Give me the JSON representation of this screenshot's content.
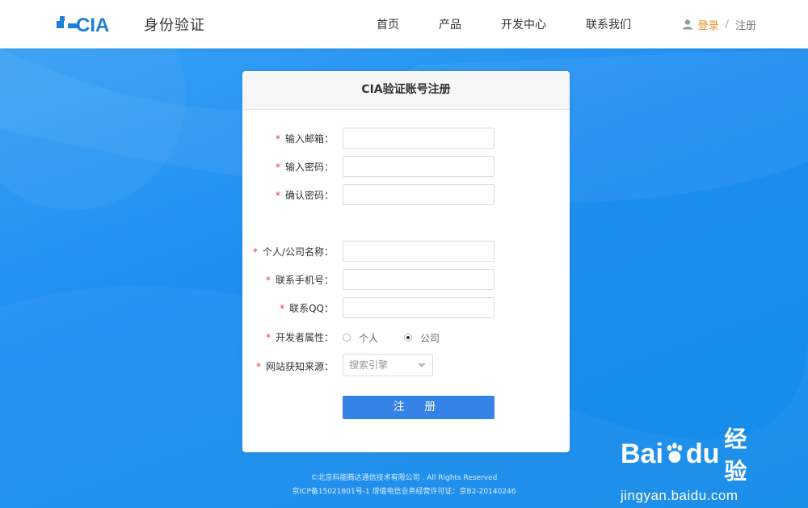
{
  "header": {
    "logo_text": "CIA",
    "site_name": "身份验证",
    "nav": [
      "首页",
      "产品",
      "开发中心",
      "联系我们"
    ],
    "login": "登录",
    "separator": "/",
    "register": "注册"
  },
  "form": {
    "title": "CIA验证账号注册",
    "required_mark": "*",
    "email_label": "输入邮箱：",
    "password_label": "输入密码：",
    "confirm_label": "确认密码：",
    "company_label": "个人/公司名称：",
    "phone_label": "联系手机号：",
    "qq_label": "联系QQ：",
    "dev_type_label": "开发者属性：",
    "dev_type_options": [
      "个人",
      "公司"
    ],
    "dev_type_selected": "公司",
    "source_label": "网站获知来源：",
    "source_selected": "搜索引擎",
    "submit": "注 册"
  },
  "footer": {
    "line1": "©北京科能腾达通信技术有限公司 . All Rights Reserved",
    "line2": "京ICP备15021801号-1  增值电信业务经营许可证：京B2-20140246"
  },
  "watermark": {
    "brand_left": "Bai",
    "brand_right": "du",
    "brand_cn": "经验",
    "url": "jingyan.baidu.com"
  },
  "colors": {
    "accent": "#3583e6",
    "login": "#f08a24",
    "required": "#e4393c"
  }
}
